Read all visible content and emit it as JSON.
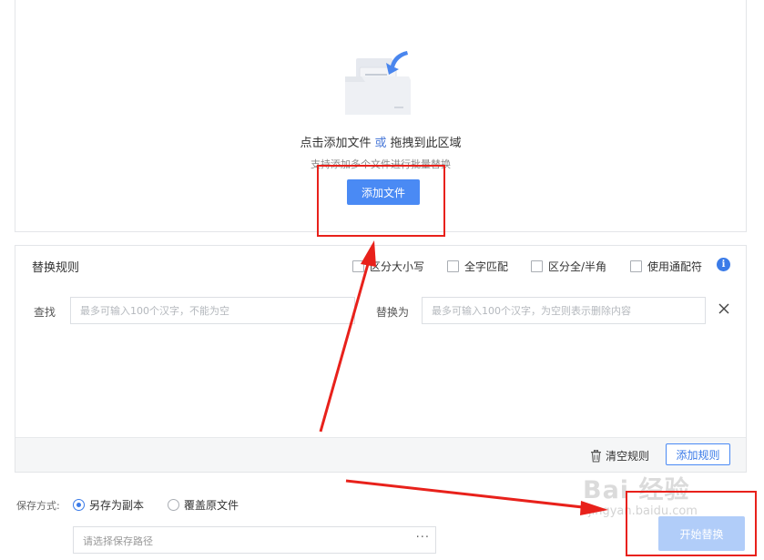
{
  "upload": {
    "title_click": "点击添加文件",
    "title_or": "或",
    "title_drag": "拖拽到此区域",
    "subtitle": "支持添加多个文件进行批量替换",
    "add_file_button": "添加文件",
    "illustration_icon": "folder-upload-icon"
  },
  "rules": {
    "title": "替换规则",
    "options": [
      {
        "label": "区分大小写",
        "checked": false
      },
      {
        "label": "全字匹配",
        "checked": false
      },
      {
        "label": "区分全/半角",
        "checked": false
      },
      {
        "label": "使用通配符",
        "checked": false
      }
    ],
    "info_icon": "info-icon",
    "find_label": "查找",
    "find_placeholder": "最多可输入100个汉字，不能为空",
    "replace_label": "替换为",
    "replace_placeholder": "最多可输入100个汉字，为空则表示删除内容",
    "clear_rules": "清空规则",
    "add_rule_button": "添加规则"
  },
  "save": {
    "label": "保存方式:",
    "options": [
      {
        "label": "另存为副本",
        "selected": true
      },
      {
        "label": "覆盖原文件",
        "selected": false
      }
    ],
    "path_placeholder": "请选择保存路径",
    "path_more": "···"
  },
  "start_button": "开始替换",
  "watermark": {
    "main": "Bai 经验",
    "sub": "jingyan.baidu.com"
  },
  "colors": {
    "primary": "#4a8af4",
    "disabled_primary": "#b1cdf9",
    "annotation_red": "#e8211b"
  }
}
